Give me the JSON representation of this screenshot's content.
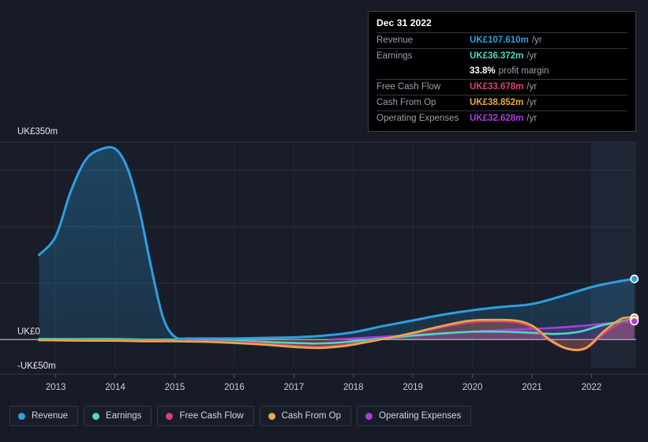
{
  "tooltip": {
    "date": "Dec 31 2022",
    "rows": [
      {
        "label": "Revenue",
        "value": "UK£107.610m",
        "unit": "/yr",
        "color": "#2e9fe0"
      },
      {
        "label": "Earnings",
        "value": "UK£36.372m",
        "unit": "/yr",
        "color": "#4fd9c0"
      },
      {
        "label": "Free Cash Flow",
        "value": "UK£33.678m",
        "unit": "/yr",
        "color": "#d6417f"
      },
      {
        "label": "Cash From Op",
        "value": "UK£38.852m",
        "unit": "/yr",
        "color": "#e8a94a"
      },
      {
        "label": "Operating Expenses",
        "value": "UK£32.628m",
        "unit": "/yr",
        "color": "#a73ee0"
      }
    ],
    "margin_value": "33.8%",
    "margin_text": "profit margin"
  },
  "legend": {
    "items": [
      {
        "label": "Revenue",
        "color": "#2e9fe0"
      },
      {
        "label": "Earnings",
        "color": "#4fd9c0"
      },
      {
        "label": "Free Cash Flow",
        "color": "#d6417f"
      },
      {
        "label": "Cash From Op",
        "color": "#e8a94a"
      },
      {
        "label": "Operating Expenses",
        "color": "#a73ee0"
      }
    ]
  },
  "axis": {
    "y_top_label": "UK£350m",
    "y_zero_label": "UK£0",
    "y_bottom_label": "-UK£50m"
  },
  "chart_data": {
    "type": "area",
    "title": "",
    "xlabel": "",
    "ylabel": "UK£m",
    "currency": "UK£",
    "unit": "m",
    "xlim": [
      2012.7,
      2022.75
    ],
    "ylim": [
      -50,
      350
    ],
    "y_ticks": [
      -50,
      0,
      100,
      200,
      300,
      350
    ],
    "y_tick_labels": [
      "-UK£50m",
      "UK£0",
      "",
      "",
      "",
      "UK£350m"
    ],
    "grid": true,
    "zero_line": 0,
    "legend_position": "bottom-left",
    "x_tick_labels": [
      "2013",
      "2014",
      "2015",
      "2016",
      "2017",
      "2018",
      "2019",
      "2020",
      "2021",
      "2022"
    ],
    "x_ticks": [
      2013,
      2014,
      2015,
      2016,
      2017,
      2018,
      2019,
      2020,
      2021,
      2022
    ],
    "forecast_region": [
      2022.0,
      2022.75
    ],
    "series": [
      {
        "name": "Revenue",
        "color": "#2e9fe0",
        "filled": true,
        "end_marker": true,
        "end_value": 107.61,
        "x": [
          2012.72,
          2013.0,
          2013.25,
          2013.5,
          2013.75,
          2014.0,
          2014.2,
          2014.4,
          2014.6,
          2014.8,
          2015.0,
          2015.25,
          2015.5,
          2016.0,
          2016.5,
          2017.0,
          2017.5,
          2018.0,
          2018.5,
          2019.0,
          2019.5,
          2020.0,
          2020.5,
          2021.0,
          2021.5,
          2022.0,
          2022.4,
          2022.72
        ],
        "values": [
          150,
          183,
          262,
          318,
          337,
          338,
          305,
          232,
          130,
          40,
          5,
          2,
          2,
          2,
          3,
          4,
          7,
          13,
          24,
          34,
          44,
          52,
          58,
          63,
          77,
          93,
          102,
          107.61
        ]
      },
      {
        "name": "Earnings",
        "color": "#4fd9c0",
        "filled": false,
        "end_marker": true,
        "end_value": 36.372,
        "x": [
          2012.72,
          2013.5,
          2014.0,
          2014.5,
          2015.0,
          2015.5,
          2016.0,
          2016.5,
          2017.0,
          2017.4,
          2017.8,
          2018.2,
          2018.6,
          2019.0,
          2019.5,
          2020.0,
          2020.5,
          2021.0,
          2021.4,
          2021.8,
          2022.2,
          2022.72
        ],
        "values": [
          1,
          1,
          1,
          0,
          0,
          -1,
          -2,
          -4,
          -6,
          -7,
          -5,
          -1,
          3,
          7,
          11,
          14,
          14,
          12,
          10,
          14,
          26,
          36.372
        ]
      },
      {
        "name": "Free Cash Flow",
        "color": "#d6417f",
        "filled": false,
        "end_marker": true,
        "end_value": 33.678,
        "x": [
          2012.72,
          2013.5,
          2014.0,
          2014.5,
          2015.0,
          2015.5,
          2016.0,
          2016.5,
          2017.0,
          2017.4,
          2017.8,
          2018.2,
          2018.6,
          2019.0,
          2019.4,
          2019.8,
          2020.0,
          2020.3,
          2020.7,
          2021.0,
          2021.3,
          2021.6,
          2021.9,
          2022.2,
          2022.5,
          2022.72
        ],
        "values": [
          -1,
          -1,
          -1,
          -2,
          -2,
          -3,
          -4,
          -7,
          -11,
          -13,
          -10,
          -4,
          3,
          11,
          20,
          28,
          31,
          32,
          31,
          22,
          -2,
          -17,
          -16,
          10,
          30,
          33.678
        ]
      },
      {
        "name": "Cash From Op",
        "color": "#e8a94a",
        "filled": false,
        "end_marker": true,
        "end_value": 38.852,
        "x": [
          2012.72,
          2013.5,
          2014.0,
          2014.5,
          2015.0,
          2015.5,
          2016.0,
          2016.5,
          2017.0,
          2017.4,
          2017.8,
          2018.2,
          2018.6,
          2019.0,
          2019.4,
          2019.8,
          2020.0,
          2020.3,
          2020.7,
          2021.0,
          2021.3,
          2021.6,
          2021.9,
          2022.2,
          2022.5,
          2022.72
        ],
        "values": [
          -1,
          -2,
          -2,
          -3,
          -3,
          -4,
          -6,
          -9,
          -13,
          -15,
          -12,
          -5,
          3,
          12,
          22,
          31,
          34,
          35,
          34,
          25,
          0,
          -16,
          -15,
          14,
          37,
          38.852
        ]
      },
      {
        "name": "Operating Expenses",
        "color": "#a73ee0",
        "filled": false,
        "end_marker": true,
        "end_value": 32.628,
        "x": [
          2017.6,
          2018.0,
          2018.5,
          2019.0,
          2019.5,
          2020.0,
          2020.5,
          2021.0,
          2021.4,
          2021.8,
          2022.2,
          2022.72
        ],
        "values": [
          0,
          2,
          5,
          8,
          11,
          14,
          17,
          19,
          21,
          24,
          28,
          32.628
        ]
      }
    ]
  }
}
